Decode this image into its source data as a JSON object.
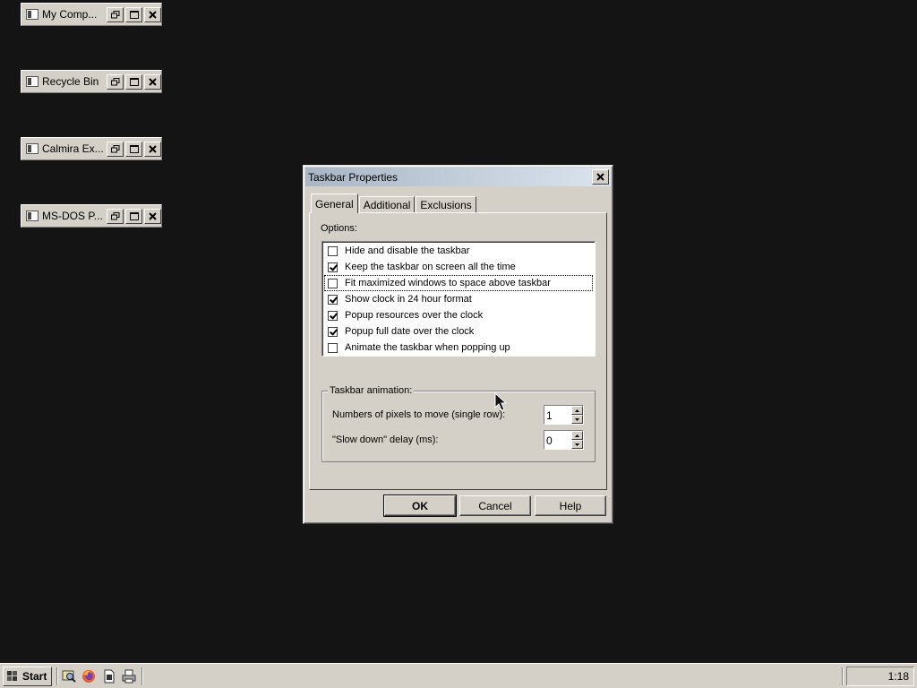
{
  "desktop_windows": [
    {
      "title": "My Comp..."
    },
    {
      "title": "Recycle Bin"
    },
    {
      "title": "Calmira Ex..."
    },
    {
      "title": "MS-DOS P..."
    }
  ],
  "dialog": {
    "title": "Taskbar Properties",
    "tabs": [
      "General",
      "Additional",
      "Exclusions"
    ],
    "active_tab": "General",
    "options_label": "Options:",
    "options": [
      {
        "label": "Hide and disable the taskbar",
        "checked": false
      },
      {
        "label": "Keep the taskbar on screen all the time",
        "checked": true
      },
      {
        "label": "Fit maximized windows to space above taskbar",
        "checked": false
      },
      {
        "label": "Show clock in 24 hour format",
        "checked": true
      },
      {
        "label": "Popup resources over the clock",
        "checked": true
      },
      {
        "label": "Popup full date over the clock",
        "checked": true
      },
      {
        "label": "Animate the taskbar when popping up",
        "checked": false
      }
    ],
    "animation": {
      "group_title": "Taskbar animation:",
      "pixels_label": "Numbers of pixels to move (single row):",
      "pixels_value": "1",
      "delay_label": "\"Slow down\" delay (ms):",
      "delay_value": "0"
    },
    "buttons": {
      "ok": "OK",
      "cancel": "Cancel",
      "help": "Help"
    }
  },
  "taskbar": {
    "start_label": "Start",
    "clock": "1:18"
  }
}
